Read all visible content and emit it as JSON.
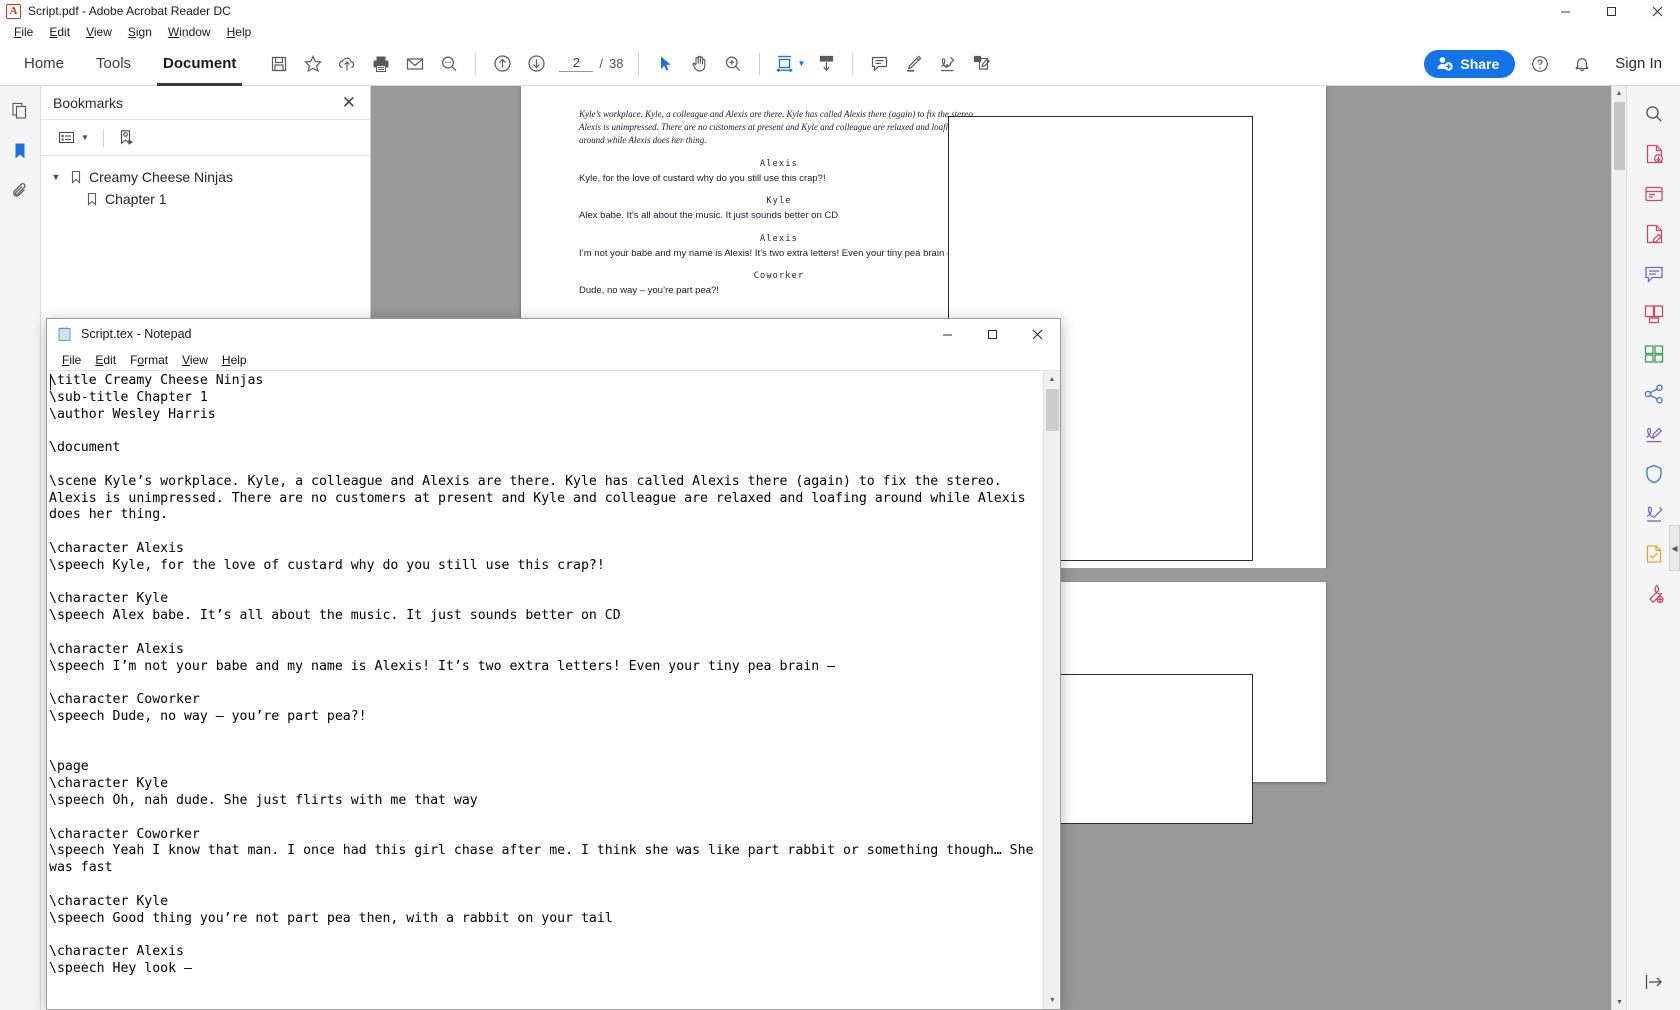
{
  "acrobat": {
    "title": "Script.pdf - Adobe Acrobat Reader DC",
    "app_icon": "A",
    "menus": [
      {
        "label": "File",
        "accel": "F"
      },
      {
        "label": "Edit",
        "accel": "E"
      },
      {
        "label": "View",
        "accel": "V"
      },
      {
        "label": "Sign",
        "accel": "S"
      },
      {
        "label": "Window",
        "accel": "W"
      },
      {
        "label": "Help",
        "accel": "H"
      }
    ],
    "tabs": [
      {
        "label": "Home",
        "active": false
      },
      {
        "label": "Tools",
        "active": false
      },
      {
        "label": "Document",
        "active": true
      }
    ],
    "toolbar_icons": [
      "save-icon",
      "add-to-favorites-icon",
      "upload-cloud-icon",
      "print-icon",
      "email-icon",
      "find-text-icon",
      "previous-page-icon",
      "next-page-icon"
    ],
    "page": {
      "current": "2",
      "separator": "/",
      "total": "38"
    },
    "tool_icons": [
      "select-cursor-icon",
      "hand-pan-icon",
      "zoom-in-icon",
      "page-fit-icon",
      "scroll-mode-icon",
      "add-comment-icon",
      "highlighter-icon",
      "signature-icon",
      "fill-and-sign-icon"
    ],
    "share_label": "Share",
    "help_icon": "help-circle-icon",
    "bell_icon": "notification-bell-icon",
    "signin_label": "Sign In",
    "window_controls": {
      "minimize": "─",
      "maximize": "□",
      "close": "✕"
    }
  },
  "left_rail": {
    "items": [
      {
        "icon": "page-thumbnails-icon",
        "active": false
      },
      {
        "icon": "bookmarks-icon",
        "active": true
      },
      {
        "icon": "attachments-icon",
        "active": false
      }
    ]
  },
  "bookmarks": {
    "title": "Bookmarks",
    "close_icon": "close-icon",
    "toolbar": [
      {
        "icon": "bookmark-options-list-icon"
      },
      {
        "icon": "new-bookmark-icon"
      }
    ],
    "items": [
      {
        "label": "Creamy Cheese Ninjas",
        "level": 0,
        "expanded": true
      },
      {
        "label": "Chapter 1",
        "level": 1,
        "expanded": false
      }
    ]
  },
  "pdf_page": {
    "scene": "Kyle’s workplace. Kyle, a colleague and Alexis are there. Kyle has called Alexis there (again) to fix the stereo. Alexis is unimpressed. There are no customers at present and Kyle and colleague are relaxed and loafing around while Alexis does her thing.",
    "lines": [
      {
        "character": "Alexis",
        "speech": "Kyle, for the love of custard why do you still use this crap?!"
      },
      {
        "character": "Kyle",
        "speech": "Alex babe. It’s all about the music. It just sounds better on CD"
      },
      {
        "character": "Alexis",
        "speech": "I’m not your babe and my name is Alexis! It’s two extra letters! Even your tiny pea brain –"
      },
      {
        "character": "Coworker",
        "speech": "Dude, no way – you’re part pea?!"
      }
    ]
  },
  "right_rail": {
    "items": [
      {
        "icon": "search-tools-icon"
      },
      {
        "icon": "export-pdf-icon"
      },
      {
        "icon": "create-pdf-icon"
      },
      {
        "icon": "edit-pdf-icon"
      },
      {
        "icon": "comment-icon"
      },
      {
        "icon": "combine-files-icon"
      },
      {
        "icon": "organize-pages-icon"
      },
      {
        "icon": "share-file-icon"
      },
      {
        "icon": "fill-and-sign-icon"
      },
      {
        "icon": "protect-icon"
      },
      {
        "icon": "certificates-icon"
      },
      {
        "icon": "send-for-signature-icon"
      },
      {
        "icon": "more-tools-icon"
      }
    ],
    "collapse_handle_icon": "chevron-left-icon",
    "bottom_icon": "expand-panel-icon"
  },
  "notepad": {
    "title": "Script.tex - Notepad",
    "icon": "notepad-document-icon",
    "menus": [
      {
        "label": "File",
        "accel": "F"
      },
      {
        "label": "Edit",
        "accel": "E"
      },
      {
        "label": "Format",
        "accel": "o"
      },
      {
        "label": "View",
        "accel": "V"
      },
      {
        "label": "Help",
        "accel": "H"
      }
    ],
    "window_controls": {
      "minimize": "─",
      "maximize": "□",
      "close": "✕"
    },
    "content": "\\title Creamy Cheese Ninjas\n\\sub-title Chapter 1\n\\author Wesley Harris\n\n\\document\n\n\\scene Kyle’s workplace. Kyle, a colleague and Alexis are there. Kyle has called Alexis there (again) to fix the stereo. Alexis is unimpressed. There are no customers at present and Kyle and colleague are relaxed and loafing around while Alexis does her thing.\n\n\\character Alexis\n\\speech Kyle, for the love of custard why do you still use this crap?!\n\n\\character Kyle\n\\speech Alex babe. It’s all about the music. It just sounds better on CD\n\n\\character Alexis\n\\speech I’m not your babe and my name is Alexis! It’s two extra letters! Even your tiny pea brain –\n\n\\character Coworker\n\\speech Dude, no way – you’re part pea?!\n\n\n\\page\n\\character Kyle\n\\speech Oh, nah dude. She just flirts with me that way\n\n\\character Coworker\n\\speech Yeah I know that man. I once had this girl chase after me. I think she was like part rabbit or something though… She was fast\n\n\\character Kyle\n\\speech Good thing you’re not part pea then, with a rabbit on your tail\n\n\\character Alexis\n\\speech Hey look –"
  }
}
